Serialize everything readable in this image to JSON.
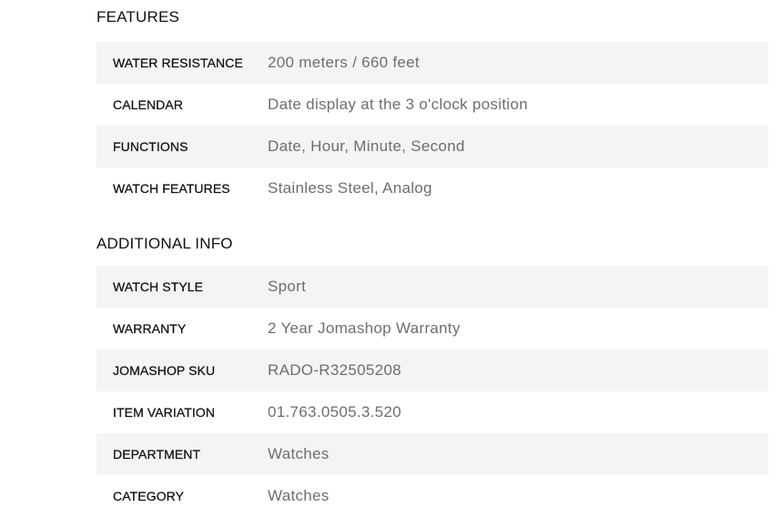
{
  "features": {
    "title": "FEATURES",
    "rows": [
      {
        "label": "WATER RESISTANCE",
        "value": "200 meters / 660 feet"
      },
      {
        "label": "CALENDAR",
        "value": "Date display at the 3 o'clock position"
      },
      {
        "label": "FUNCTIONS",
        "value": "Date, Hour, Minute, Second"
      },
      {
        "label": "WATCH FEATURES",
        "value": "Stainless Steel, Analog"
      }
    ]
  },
  "additional_info": {
    "title": "ADDITIONAL INFO",
    "rows": [
      {
        "label": "WATCH STYLE",
        "value": "Sport"
      },
      {
        "label": "WARRANTY",
        "value": "2 Year Jomashop Warranty"
      },
      {
        "label": "JOMASHOP SKU",
        "value": "RADO-R32505208"
      },
      {
        "label": "ITEM VARIATION",
        "value": "01.763.0505.3.520"
      },
      {
        "label": "DEPARTMENT",
        "value": "Watches"
      },
      {
        "label": "CATEGORY",
        "value": "Watches"
      }
    ]
  },
  "colors": {
    "row_shaded": "#f4f4f4",
    "label_text": "#111111",
    "value_text": "#6e6e6e"
  }
}
